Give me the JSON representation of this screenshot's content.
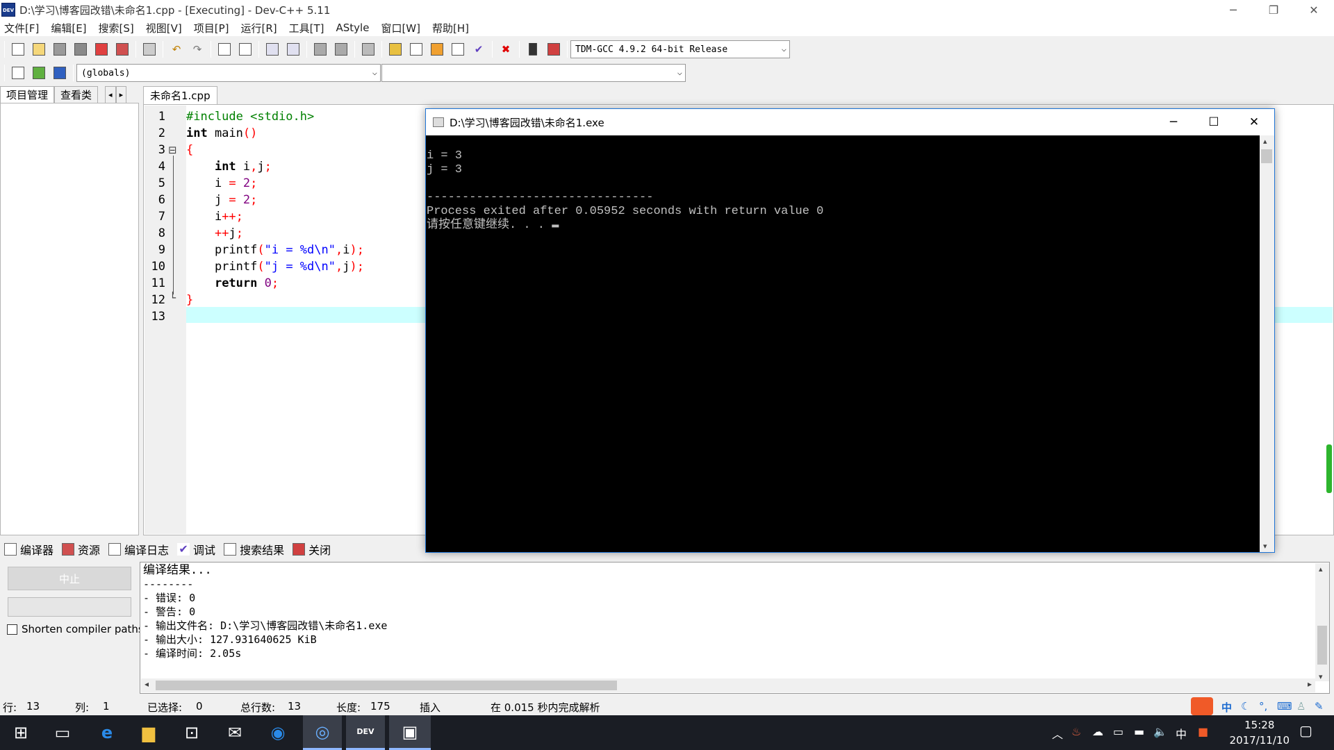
{
  "window": {
    "title": "D:\\学习\\博客园改错\\未命名1.cpp - [Executing] - Dev-C++ 5.11",
    "app_icon": "DEV",
    "controls": {
      "minimize": "─",
      "restore": "❐",
      "close": "✕"
    }
  },
  "menu": [
    "文件[F]",
    "编辑[E]",
    "搜索[S]",
    "视图[V]",
    "项目[P]",
    "运行[R]",
    "工具[T]",
    "AStyle",
    "窗口[W]",
    "帮助[H]"
  ],
  "toolbar": {
    "compiler_select": "TDM-GCC 4.9.2 64-bit Release",
    "scope_select": "(globals)",
    "symbol_select": ""
  },
  "left_tabs": [
    "项目管理",
    "查看类"
  ],
  "editor": {
    "file_tab": "未命名1.cpp",
    "line_numbers": [
      "1",
      "2",
      "3",
      "4",
      "5",
      "6",
      "7",
      "8",
      "9",
      "10",
      "11",
      "12",
      "13"
    ],
    "fold_markers": {
      "open": "⊟",
      "close": "└"
    }
  },
  "console": {
    "title": "D:\\学习\\博客园改错\\未命名1.exe",
    "lines": [
      "i = 3",
      "j = 3",
      "",
      "--------------------------------",
      "Process exited after 0.05952 seconds with return value 0",
      "请按任意键继续. . . ▬"
    ],
    "controls": {
      "minimize": "─",
      "maximize": "☐",
      "close": "✕"
    }
  },
  "bottom_tabs": [
    {
      "icon": "grid-icon",
      "label": "编译器"
    },
    {
      "icon": "resources-icon",
      "label": "资源"
    },
    {
      "icon": "chart-icon",
      "label": "编译日志"
    },
    {
      "icon": "check-icon",
      "label": "调试"
    },
    {
      "icon": "search-icon",
      "label": "搜索结果"
    },
    {
      "icon": "close-icon",
      "label": "关闭"
    }
  ],
  "compile_panel": {
    "stop_button": "中止",
    "shorten_label": "Shorten compiler paths",
    "log_lines": [
      "编译结果...",
      "--------",
      "- 错误: 0",
      "- 警告: 0",
      "- 输出文件名: D:\\学习\\博客园改错\\未命名1.exe",
      "- 输出大小: 127.931640625 KiB",
      "- 编译时间: 2.05s"
    ]
  },
  "status": {
    "row_label": "行:",
    "row_value": "13",
    "col_label": "列:",
    "col_value": "1",
    "sel_label": "已选择:",
    "sel_value": "0",
    "lines_label": "总行数:",
    "lines_value": "13",
    "len_label": "长度:",
    "len_value": "175",
    "mode": "插入",
    "parse_msg": "在 0.015 秒内完成解析"
  },
  "taskbar": {
    "time": "15:28",
    "date": "2017/11/10",
    "ime": "中"
  }
}
